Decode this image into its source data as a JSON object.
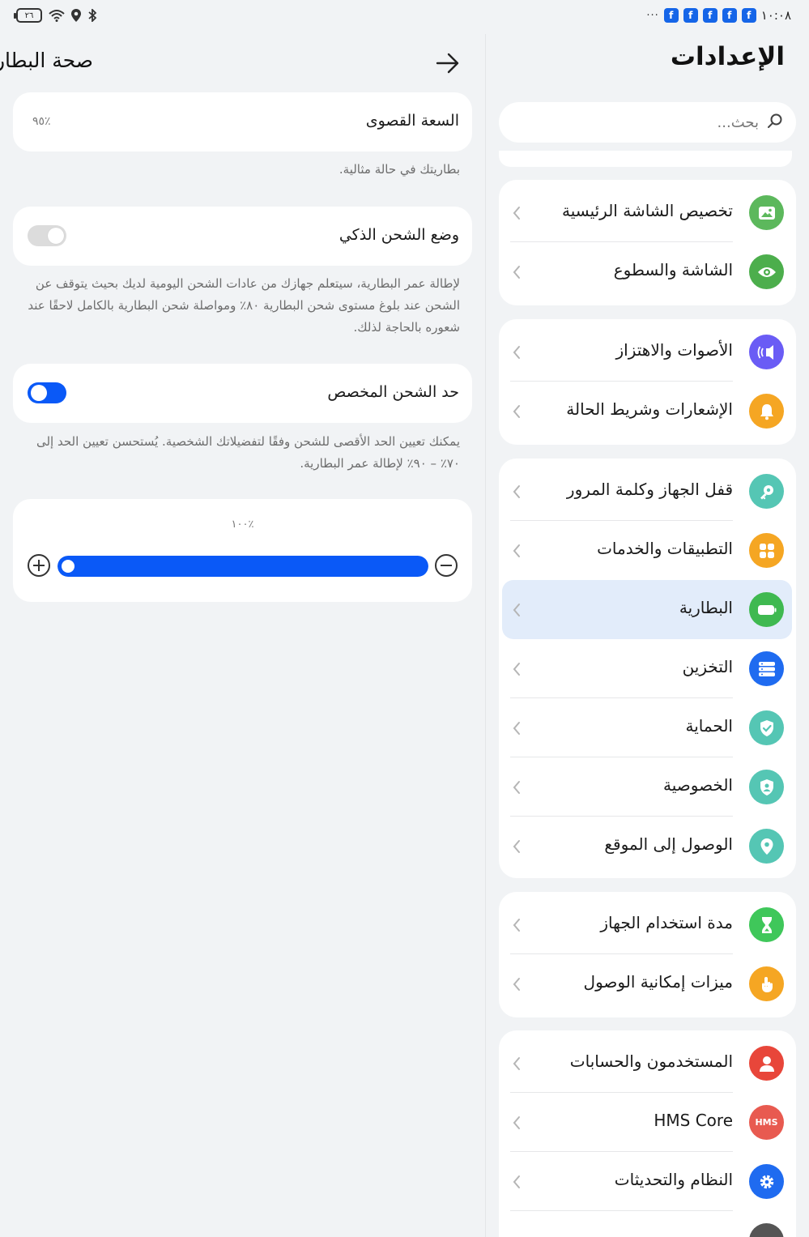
{
  "status_bar": {
    "battery_level": "٢٦",
    "time": "١٠:٠٨",
    "notifications_overflow": "···",
    "notification_app_count": 5
  },
  "settings": {
    "title": "الإعدادات",
    "search_placeholder": "بحث...",
    "groups": [
      {
        "items": [
          {
            "label": "تخصيص الشاشة الرئيسية",
            "icon": "wallpaper-icon",
            "color": "#5cb85c"
          },
          {
            "label": "الشاشة والسطوع",
            "icon": "eye-icon",
            "color": "#4cae4c"
          }
        ]
      },
      {
        "items": [
          {
            "label": "الأصوات والاهتزاز",
            "icon": "sound-icon",
            "color": "#6a5cf5"
          },
          {
            "label": "الإشعارات وشريط الحالة",
            "icon": "bell-icon",
            "color": "#f5a623"
          }
        ]
      },
      {
        "items": [
          {
            "label": "قفل الجهاز وكلمة المرور",
            "icon": "key-icon",
            "color": "#55c6b4"
          },
          {
            "label": "التطبيقات والخدمات",
            "icon": "apps-icon",
            "color": "#f5a623"
          },
          {
            "label": "البطارية",
            "icon": "battery-icon",
            "color": "#3fb950",
            "selected": true
          },
          {
            "label": "التخزين",
            "icon": "storage-icon",
            "color": "#1f6bf0"
          },
          {
            "label": "الحماية",
            "icon": "shield-check-icon",
            "color": "#55c6b4"
          },
          {
            "label": "الخصوصية",
            "icon": "privacy-icon",
            "color": "#55c6b4"
          },
          {
            "label": "الوصول إلى الموقع",
            "icon": "location-icon",
            "color": "#55c6b4"
          }
        ]
      },
      {
        "items": [
          {
            "label": "مدة استخدام الجهاز",
            "icon": "hourglass-icon",
            "color": "#3fc75a"
          },
          {
            "label": "ميزات إمكانية الوصول",
            "icon": "hand-icon",
            "color": "#f5a623"
          }
        ]
      },
      {
        "items": [
          {
            "label": "المستخدمون والحسابات",
            "icon": "user-icon",
            "color": "#e8463a"
          },
          {
            "label": "HMS Core",
            "icon": "hms-icon",
            "color": "#e85a50",
            "icon_text": "HMS"
          },
          {
            "label": "النظام والتحديثات",
            "icon": "gear-icon",
            "color": "#1f6bf0"
          }
        ]
      }
    ]
  },
  "battery_health": {
    "title": "صحة البطارية",
    "max_capacity_label": "السعة القصوى",
    "max_capacity_value": "٪٩٥",
    "capacity_note": "بطاريتك في حالة مثالية.",
    "smart_charging_label": "وضع الشحن الذكي",
    "smart_charging_enabled": false,
    "smart_charging_note": "لإطالة عمر البطارية، سيتعلم جهازك من عادات الشحن اليومية لديك بحيث يتوقف عن الشحن عند بلوغ مستوى شحن البطارية ٨٠٪ ومواصلة شحن البطارية بالكامل لاحقًا عند شعوره بالحاجة لذلك.",
    "custom_limit_label": "حد الشحن المخصص",
    "custom_limit_enabled": true,
    "custom_limit_note": "يمكنك تعيين الحد الأقصى للشحن وفقًا لتفضيلاتك الشخصية. يُستحسن تعيين الحد إلى ٧٠٪ – ٩٠٪ لإطالة عمر البطارية.",
    "limit_value_text": "٪١٠٠",
    "limit_fraction": 1.0
  },
  "colors": {
    "accent": "#0a59f7",
    "selected_row_bg": "#e2ecfa",
    "page_bg": "#f1f3f5"
  }
}
